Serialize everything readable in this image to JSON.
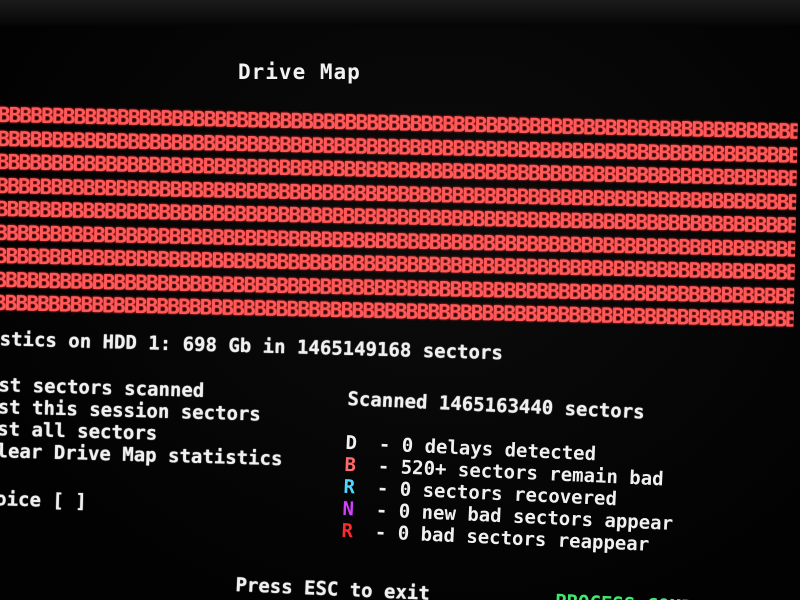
{
  "screen": {
    "title": "Drive Map",
    "drive_map": {
      "rows": [
        "BBBBBBBBBBBBBBBBBBBBBBBBBBBBBBBBBBBBBBBBBBBBBBBBBBBBBBBBBBBBBBBBBBBBBBBBBBBBBBBBBBB",
        "BBBBBBBBBBBBBBBBBBBBBBBBBBBBBBBBBBBBBBBBBBBBBBBBBBBBBBBBBBBBBBBBBBBBBBBBBBBBBBBBBBB",
        "BBBBBBBBBBBBBBBBBBBBBBBBBBBBBBBBBBBBBBBBBBBBBBBBBBBBBBBBBBBBBBBBBBBBBBBBBBBBBBBBBBB",
        "BBBBBBBBBBBBBBBBBBBBBBBBBBBBBBBBBBBBBBBBBBBBBBBBBBBBBBBBBBBBBBBBBBBBBBBBBBBBBBBBBBB",
        "BBBBBBBBBBBBBBBBBBBBBBBBBBBBBBBBBBBBBBBBBBBBBBBBBBBBBBBBBBBBBBBBBBBBBBBBBBBBBBBBBBB",
        "BBBBBBBBBBBBBBBBBBBBBBBBBBBBBBBBBBBBBBBBBBBBBBBBBBBBBBBBBBBBBBBBBBBBBBBBBBBBBBBBBBB",
        "BBBBBBBBBBBBBBBBBBBBBBBBBBBBBBBBBBBBBBBBBBBBBBBBBBBBBBBBBBBBBBBBBBBBBBBBBBBBBBBBBBB",
        "BBBBBBBBBBBBBBBBBBBBBBBBBBBBBBBBBBBBBBBBBBBBBBBBBBBBBBBBBBBBBBBBBBBBBBBBBBBBBBBBBBB",
        "BBBBBBBBBBBBBBBBBBBBBBBBBBBBBBBBBBBBBBBBBBBBBBBBBBBBBBBBBBBBBBBBBBBBBBBBBBBBBBBBBBB"
      ],
      "sector_color": "#ff5a5a"
    },
    "statistics_line": "stics on HDD 1: 698 Gb in 1465149168 sectors",
    "menu": [
      "st sectors scanned",
      "st this session sectors",
      "st all sectors",
      "lear Drive Map statistics"
    ],
    "choice_prompt": "oice [ ]",
    "scanned_line": "Scanned 1465163440 sectors",
    "legend": [
      {
        "key": "D",
        "color": "#f0f0f0",
        "text": "- 0 delays detected"
      },
      {
        "key": "B",
        "color": "#ff6a6a",
        "text": "- 520+ sectors remain bad"
      },
      {
        "key": "R",
        "color": "#4fd7ff",
        "text": "- 0 sectors recovered"
      },
      {
        "key": "N",
        "color": "#d040ff",
        "text": "- 0 new bad sectors appear"
      },
      {
        "key": "R",
        "color": "#ff2a2a",
        "text": "- 0 bad sectors reappear"
      }
    ],
    "footer": {
      "hint": "Press ESC to exit",
      "status": "PROCESS COMPL"
    }
  }
}
